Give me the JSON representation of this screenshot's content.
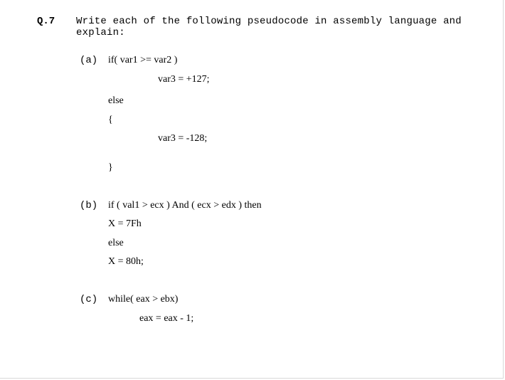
{
  "question": {
    "number": "Q.7",
    "prompt": "Write each of the following pseudocode in assembly language and explain:"
  },
  "parts": {
    "a": {
      "label": "(a)",
      "l1": "if( var1 >= var2 )",
      "l2": "var3 = +127;",
      "l3": "else",
      "l4": "{",
      "l5": "var3 = -128;",
      "l6": "}"
    },
    "b": {
      "label": "(b)",
      "l1": "if ( val1 > ecx ) And ( ecx > edx ) then",
      "l2": "X = 7Fh",
      "l3": "else",
      "l4": "X = 80h;"
    },
    "c": {
      "label": "(c)",
      "l1": "while( eax > ebx)",
      "l2": "eax = eax - 1;"
    }
  }
}
